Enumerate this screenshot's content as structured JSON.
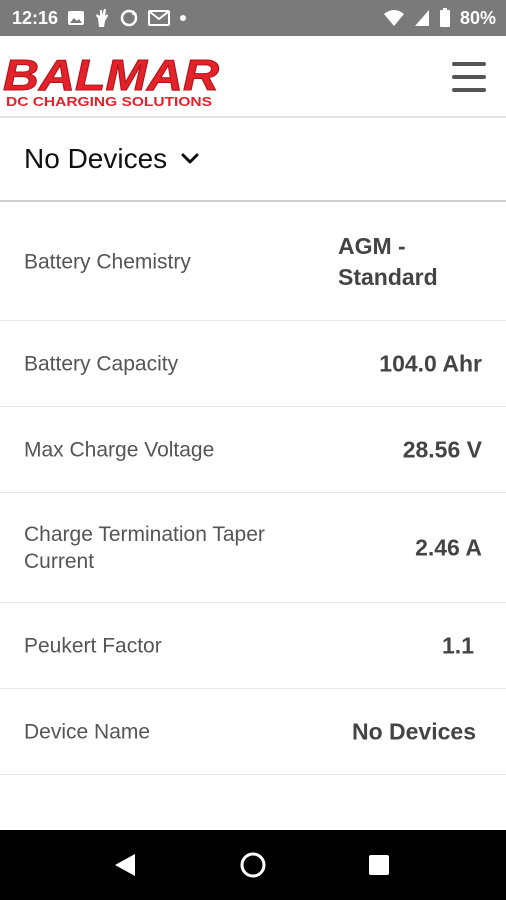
{
  "status_bar": {
    "time": "12:16",
    "battery_pct": "80%"
  },
  "header": {
    "logo_text": "BALMAR",
    "logo_tagline": "DC CHARGING SOLUTIONS",
    "brand_color": "#e3222a"
  },
  "device_selector": {
    "label": "No Devices"
  },
  "settings": [
    {
      "label": "Battery Chemistry",
      "value": "AGM - Standard"
    },
    {
      "label": "Battery Capacity",
      "value": "104.0 Ahr"
    },
    {
      "label": "Max Charge Voltage",
      "value": "28.56 V"
    },
    {
      "label": "Charge Termination Taper Current",
      "value": "2.46 A"
    },
    {
      "label": "Peukert Factor",
      "value": "1.1"
    },
    {
      "label": "Device Name",
      "value": "No Devices"
    }
  ]
}
